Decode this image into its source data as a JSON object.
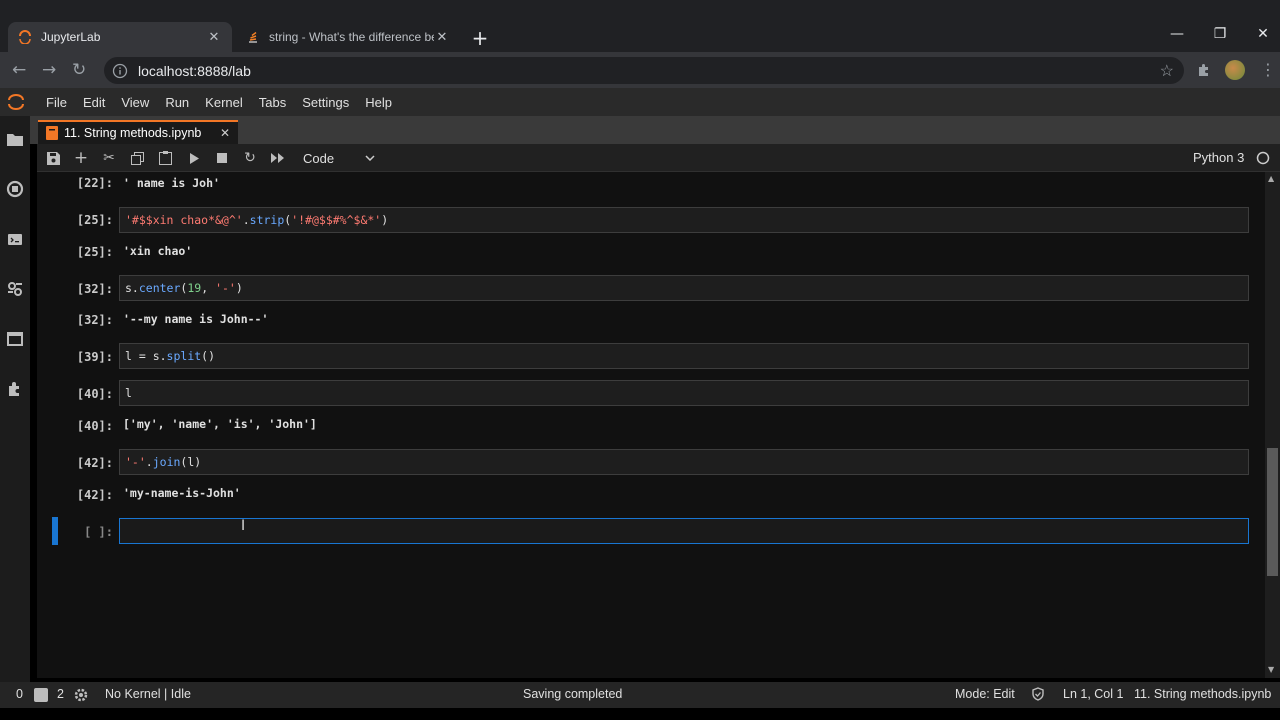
{
  "browser": {
    "tabs": [
      {
        "title": "JupyterLab",
        "icon": "jupyter-logo-icon",
        "active": true
      },
      {
        "title": "string - What's the difference bet",
        "icon": "stackoverflow-icon",
        "active": false
      }
    ],
    "new_tab": "+",
    "url": "localhost:8888/lab",
    "window_controls": {
      "minimize": "—",
      "restore": "❐",
      "close": "✕"
    }
  },
  "menubar": {
    "items": [
      "File",
      "Edit",
      "View",
      "Run",
      "Kernel",
      "Tabs",
      "Settings",
      "Help"
    ]
  },
  "document_tab": {
    "title": "11. String methods.ipynb",
    "close": "✕"
  },
  "toolbar": {
    "cell_type": "Code",
    "kernel_name": "Python 3"
  },
  "notebook": {
    "cells": [
      {
        "kind": "output",
        "prompt": "[22]:",
        "text": "' name is Joh'"
      },
      {
        "kind": "input",
        "prompt": "[25]:",
        "code": "'#$$xin chao*&@^'.strip('!#@$$#%^$&*')"
      },
      {
        "kind": "output",
        "prompt": "[25]:",
        "text": "'xin chao'"
      },
      {
        "kind": "input",
        "prompt": "[32]:",
        "code": "s.center(19, '-')"
      },
      {
        "kind": "output",
        "prompt": "[32]:",
        "text": "'--my name is John--'"
      },
      {
        "kind": "input",
        "prompt": "[39]:",
        "code": "l = s.split()"
      },
      {
        "kind": "input",
        "prompt": "[40]:",
        "code": "l"
      },
      {
        "kind": "output",
        "prompt": "[40]:",
        "text": "['my', 'name', 'is', 'John']"
      },
      {
        "kind": "input",
        "prompt": "[42]:",
        "code": "'-'.join(l)"
      },
      {
        "kind": "output",
        "prompt": "[42]:",
        "text": "'my-name-is-John'"
      },
      {
        "kind": "input",
        "prompt": "[ ]:",
        "code": ""
      }
    ],
    "code_parts": {
      "c25_str1": "'#$$xin chao*&@^'",
      "c25_dot": ".",
      "c25_fn": "strip",
      "c25_open": "(",
      "c25_str2": "'!#@$$#%^$&*'",
      "c25_close": ")",
      "c32_var": "s.",
      "c32_fn": "center",
      "c32_open": "(",
      "c32_num": "19",
      "c32_sep": ", ",
      "c32_str": "'-'",
      "c32_close": ")",
      "c39_lhs": "l = s.",
      "c39_fn": "split",
      "c39_call": "()",
      "c40_code": "l",
      "c42_str": "'-'",
      "c42_dot": ".",
      "c42_fn": "join",
      "c42_args": "(l)"
    }
  },
  "statusbar": {
    "terminals": "0",
    "consoles": "2",
    "kernel_status": "No Kernel | Idle",
    "message": "Saving completed",
    "mode": "Mode: Edit",
    "cursor": "Ln 1, Col 1",
    "filename": "11. String methods.ipynb"
  },
  "colors": {
    "accent": "#f37726",
    "active_cell_bar": "#1976d2",
    "string": "#ff7b72",
    "function": "#6aa9ff",
    "number": "#7fd18c"
  }
}
